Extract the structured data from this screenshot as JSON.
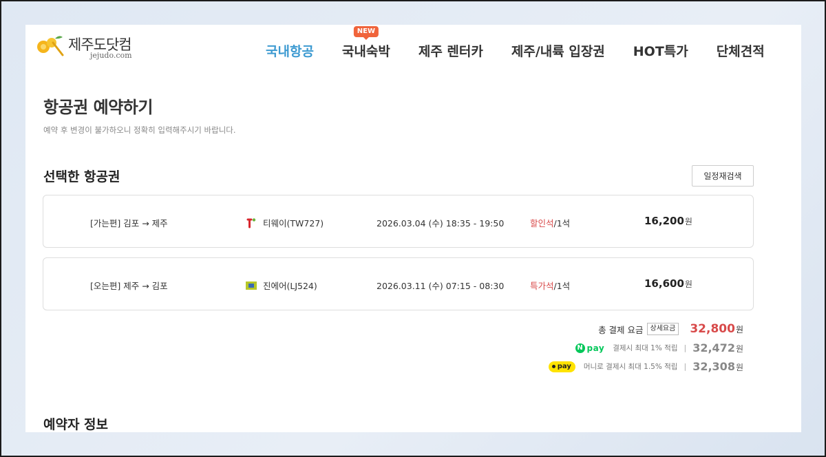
{
  "brand": {
    "name": "제주도닷컴",
    "domain": "jejudo.com"
  },
  "nav": {
    "items": [
      {
        "label": "국내항공",
        "active": true
      },
      {
        "label": "국내숙박",
        "badge": "NEW"
      },
      {
        "label": "제주 렌터카"
      },
      {
        "label": "제주/내륙 입장권"
      },
      {
        "label": "HOT특가"
      },
      {
        "label": "단체견적"
      }
    ]
  },
  "page": {
    "title": "항공권 예약하기",
    "subtitle": "예약 후 변경이 불가하오니 정확히 입력해주시기 바랍니다."
  },
  "selected": {
    "title": "선택한 항공권",
    "research_label": "일정재검색",
    "flights": [
      {
        "direction": "[가는편]",
        "route": "김포 → 제주",
        "airline": "티웨이(TW727)",
        "airline_icon": "tway-logo-icon",
        "datetime": "2026.03.04 (수) 18:35 - 19:50",
        "seat_class": "할인석",
        "seat_count": "/1석",
        "price": "16,200",
        "unit": "원"
      },
      {
        "direction": "[오는편]",
        "route": "제주 → 김포",
        "airline": "진에어(LJ524)",
        "airline_icon": "jinair-logo-icon",
        "datetime": "2026.03.11 (수) 07:15 - 08:30",
        "seat_class": "특가석",
        "seat_count": "/1석",
        "price": "16,600",
        "unit": "원"
      }
    ]
  },
  "totals": {
    "label": "총 결제 요금",
    "detail_label": "상세요금",
    "amount": "32,800",
    "unit": "원",
    "npay": {
      "logo_n": "N",
      "logo_text": "pay",
      "note": "결제시 최대 1% 적립",
      "separator": "|",
      "amount": "32,472",
      "unit": "원"
    },
    "kakaopay": {
      "logo_text": "pay",
      "note": "머니로 결제시 최대 1.5% 적립",
      "separator": "|",
      "amount": "32,308",
      "unit": "원"
    }
  },
  "booker": {
    "title": "예약자 정보"
  },
  "colors": {
    "accent": "#3d9ad1",
    "price_red": "#d84a4a",
    "badge": "#f0643b",
    "npay_green": "#03c75a",
    "kakao_yellow": "#ffe300"
  }
}
